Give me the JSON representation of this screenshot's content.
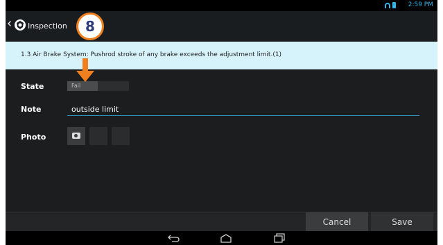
{
  "status_bar": {
    "time": "2:59 PM"
  },
  "action_bar": {
    "title": "Inspection"
  },
  "callout_badge": "8",
  "banner": {
    "text": "1.3 Air Brake System: Pushrod stroke of any brake exceeds the adjustment limit.(1)"
  },
  "form": {
    "state_label": "State",
    "state_value": "Fail",
    "note_label": "Note",
    "note_value": "outside limit",
    "photo_label": "Photo"
  },
  "buttons": {
    "cancel": "Cancel",
    "save": "Save"
  },
  "icons": {
    "back": "chevron-left-icon",
    "logo": "app-logo-icon",
    "wifi": "wifi-icon",
    "battery": "battery-icon",
    "camera": "camera-icon",
    "arrow": "down-arrow-icon",
    "nav_back": "nav-back-icon",
    "nav_home": "nav-home-icon",
    "nav_recent": "nav-recent-icon"
  },
  "colors": {
    "accent": "#33b5e5",
    "banner_bg": "#d6f2fb",
    "callout": "#f07f1f",
    "background": "#16181a"
  }
}
